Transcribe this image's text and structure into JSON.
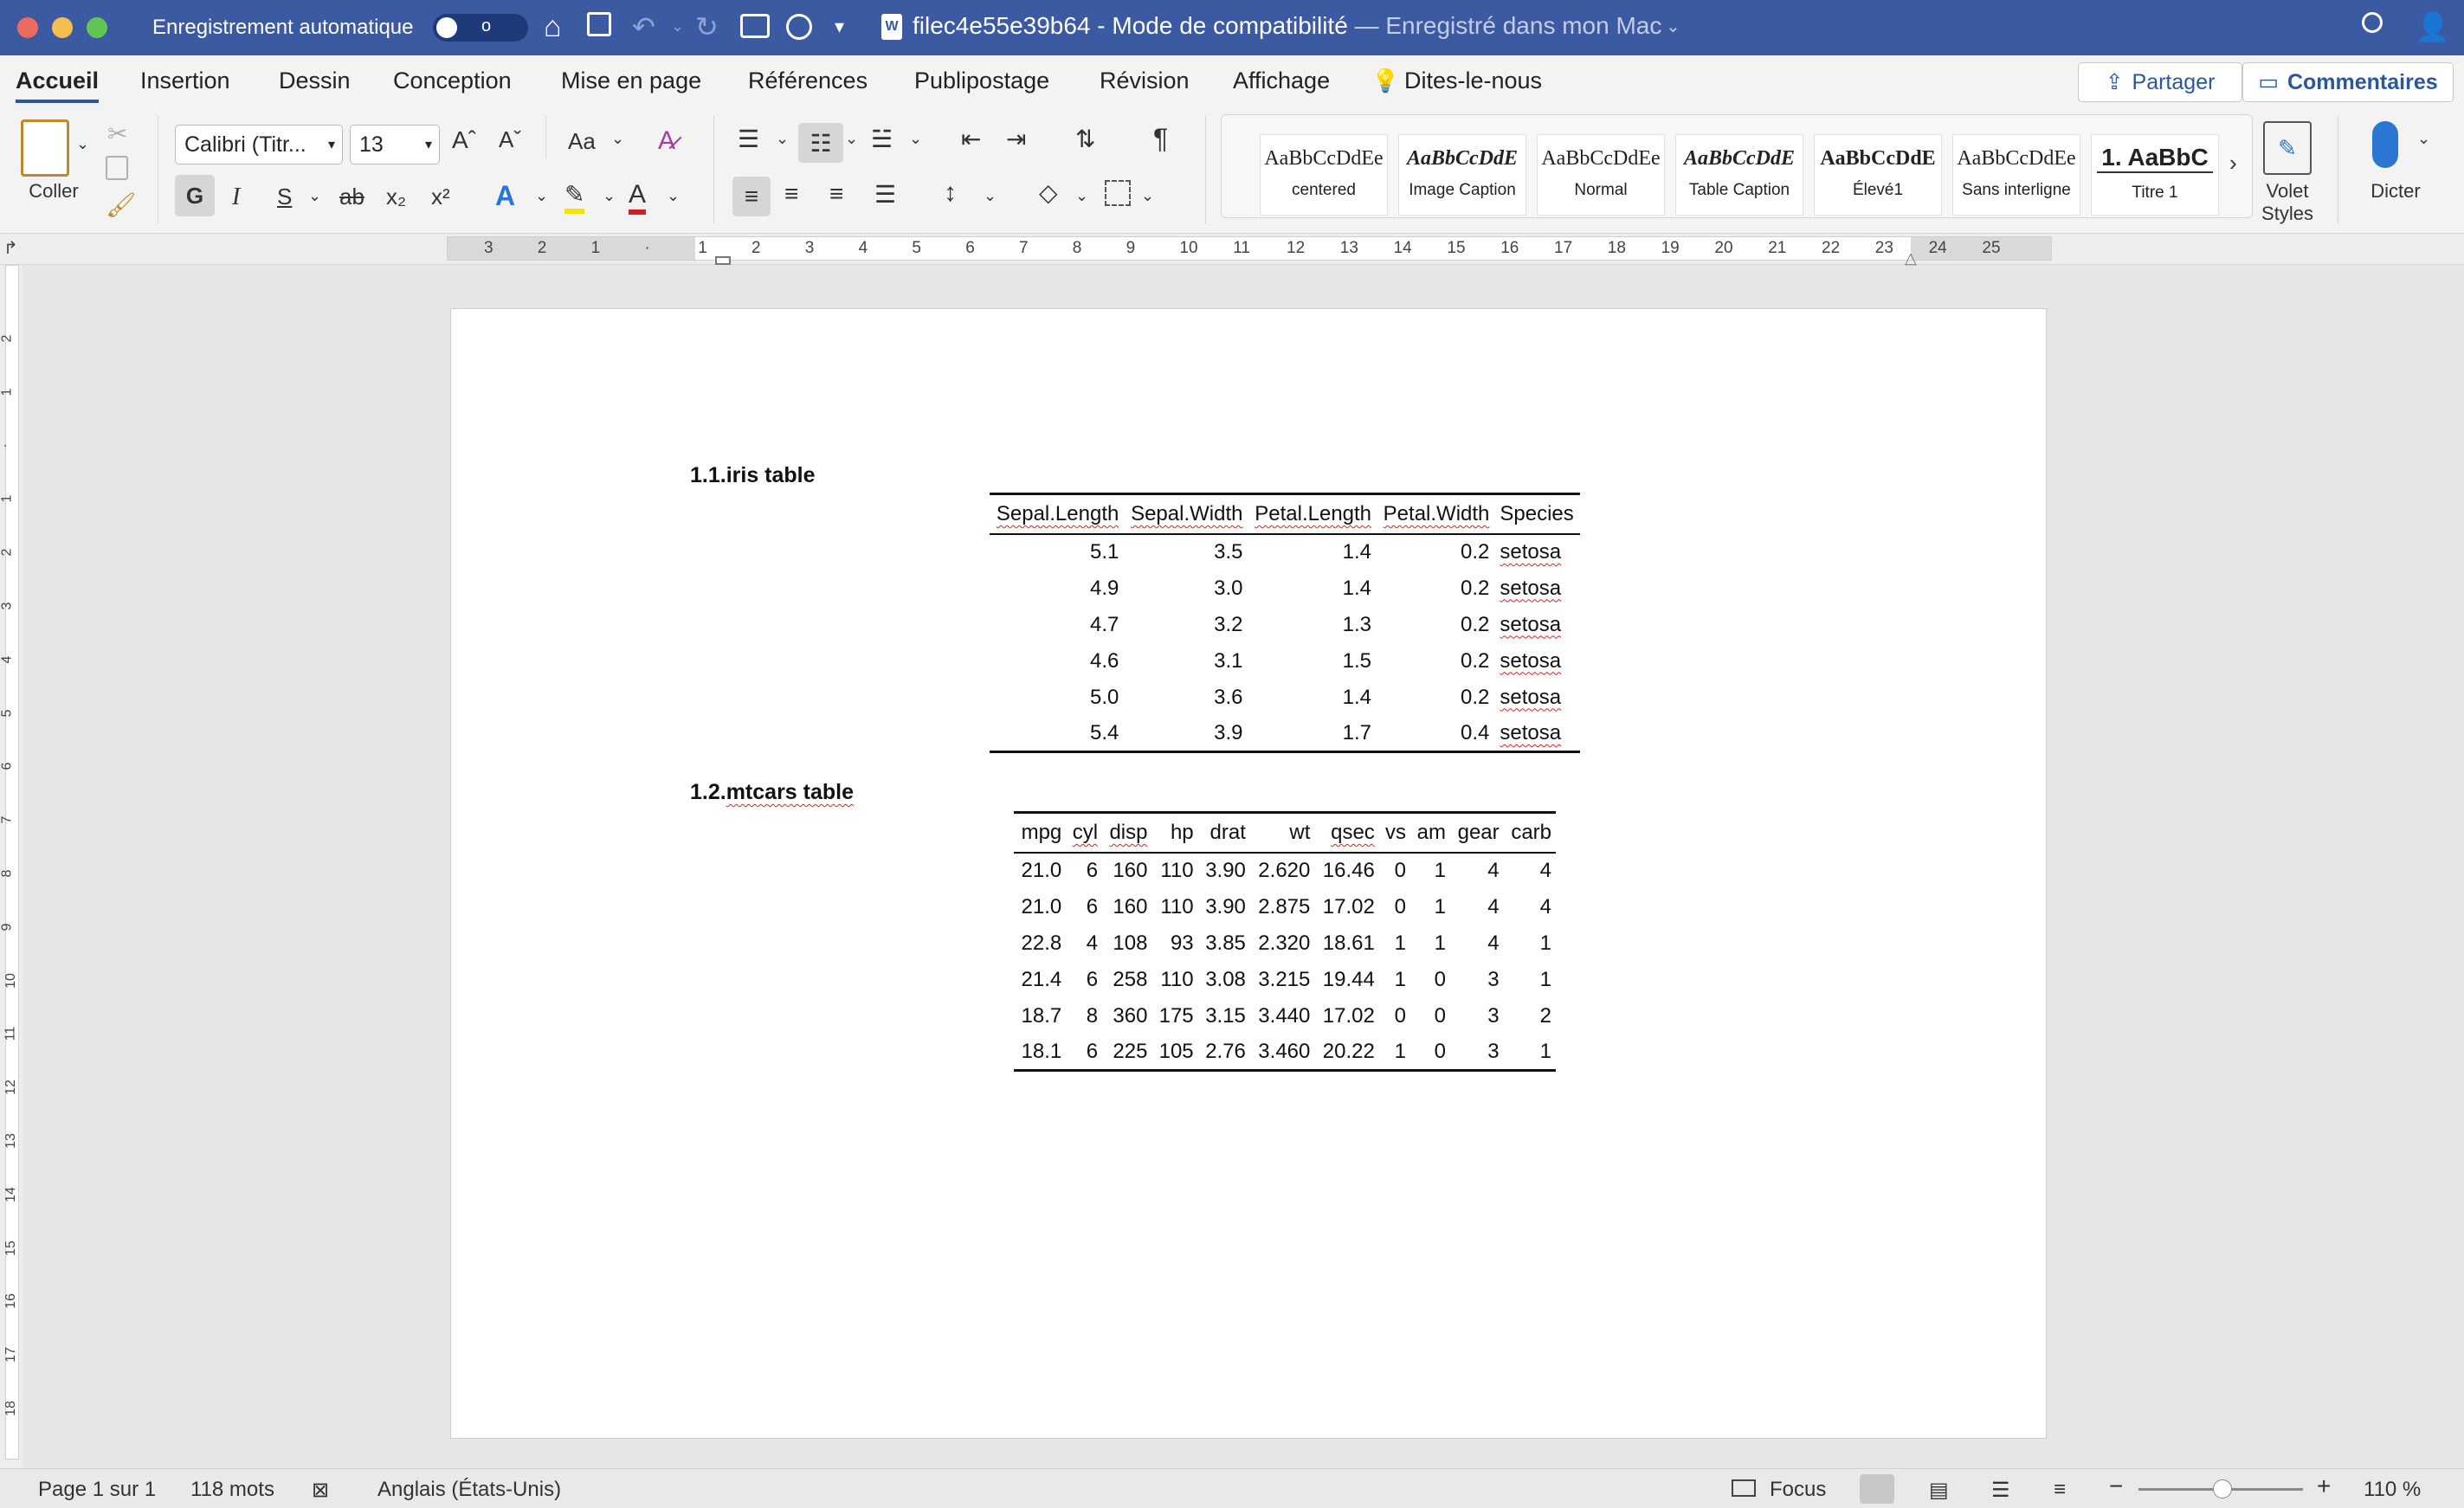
{
  "titlebar": {
    "autosave_label": "Enregistrement automatique",
    "toggle_state": "o",
    "doc_name": "filec4e55e39b64",
    "separator": "-",
    "mode": "Mode de compatibilité",
    "saved": "— Enregistré dans mon Mac"
  },
  "tabs": [
    "Accueil",
    "Insertion",
    "Dessin",
    "Conception",
    "Mise en page",
    "Références",
    "Publipostage",
    "Révision",
    "Affichage",
    "Dites-le-nous"
  ],
  "share_label": "Partager",
  "comments_label": "Commentaires",
  "ribbon": {
    "paste_label": "Coller",
    "font_name": "Calibri (Titr...",
    "font_size": "13",
    "bold": "G",
    "italic": "I",
    "underline": "S",
    "strike": "ab",
    "subscript": "x₂",
    "superscript": "x²",
    "change_case": "Aa",
    "pane_label": "Volet Styles",
    "dictate_label": "Dicter"
  },
  "styles": [
    {
      "preview": "AaBbCcDdEe",
      "name": "centered"
    },
    {
      "preview": "AaBbCcDdE",
      "name": "Image Caption"
    },
    {
      "preview": "AaBbCcDdEe",
      "name": "Normal"
    },
    {
      "preview": "AaBbCcDdE",
      "name": "Table Caption"
    },
    {
      "preview": "AaBbCcDdE",
      "name": "Élevé1"
    },
    {
      "preview": "AaBbCcDdEe",
      "name": "Sans interligne"
    },
    {
      "preview": "1. AaBbC",
      "name": "Titre 1"
    }
  ],
  "ruler_numbers": [
    "3",
    "2",
    "1",
    "",
    "1",
    "2",
    "3",
    "4",
    "5",
    "6",
    "7",
    "8",
    "9",
    "10",
    "11",
    "12",
    "13",
    "14",
    "15",
    "16",
    "17",
    "18",
    "19",
    "20",
    "21",
    "22",
    "23",
    "24",
    "25"
  ],
  "vruler_numbers": [
    "2",
    "1",
    "",
    "1",
    "2",
    "3",
    "4",
    "5",
    "6",
    "7",
    "8",
    "9",
    "10",
    "11",
    "12",
    "13",
    "14",
    "15",
    "16",
    "17",
    "18"
  ],
  "doc": {
    "iris_heading_num": "1.1.",
    "iris_heading_text": "iris table",
    "iris_headers": [
      "Sepal.Length",
      "Sepal.Width",
      "Petal.Length",
      "Petal.Width",
      "Species"
    ],
    "iris_rows": [
      [
        "5.1",
        "3.5",
        "1.4",
        "0.2",
        "setosa"
      ],
      [
        "4.9",
        "3.0",
        "1.4",
        "0.2",
        "setosa"
      ],
      [
        "4.7",
        "3.2",
        "1.3",
        "0.2",
        "setosa"
      ],
      [
        "4.6",
        "3.1",
        "1.5",
        "0.2",
        "setosa"
      ],
      [
        "5.0",
        "3.6",
        "1.4",
        "0.2",
        "setosa"
      ],
      [
        "5.4",
        "3.9",
        "1.7",
        "0.4",
        "setosa"
      ]
    ],
    "mtcars_heading_num": "1.2.",
    "mtcars_heading_text": "mtcars table",
    "mtcars_headers": [
      "mpg",
      "cyl",
      "disp",
      "hp",
      "drat",
      "wt",
      "qsec",
      "vs",
      "am",
      "gear",
      "carb"
    ],
    "mtcars_rows": [
      [
        "21.0",
        "6",
        "160",
        "110",
        "3.90",
        "2.620",
        "16.46",
        "0",
        "1",
        "4",
        "4"
      ],
      [
        "21.0",
        "6",
        "160",
        "110",
        "3.90",
        "2.875",
        "17.02",
        "0",
        "1",
        "4",
        "4"
      ],
      [
        "22.8",
        "4",
        "108",
        "93",
        "3.85",
        "2.320",
        "18.61",
        "1",
        "1",
        "4",
        "1"
      ],
      [
        "21.4",
        "6",
        "258",
        "110",
        "3.08",
        "3.215",
        "19.44",
        "1",
        "0",
        "3",
        "1"
      ],
      [
        "18.7",
        "8",
        "360",
        "175",
        "3.15",
        "3.440",
        "17.02",
        "0",
        "0",
        "3",
        "2"
      ],
      [
        "18.1",
        "6",
        "225",
        "105",
        "2.76",
        "3.460",
        "20.22",
        "1",
        "0",
        "3",
        "1"
      ]
    ]
  },
  "status": {
    "page": "Page 1 sur 1",
    "words": "118 mots",
    "language": "Anglais (États-Unis)",
    "focus": "Focus",
    "zoom": "110 %"
  },
  "colors": {
    "titlebar": "#3b5aa2",
    "accent": "#2b579a"
  }
}
